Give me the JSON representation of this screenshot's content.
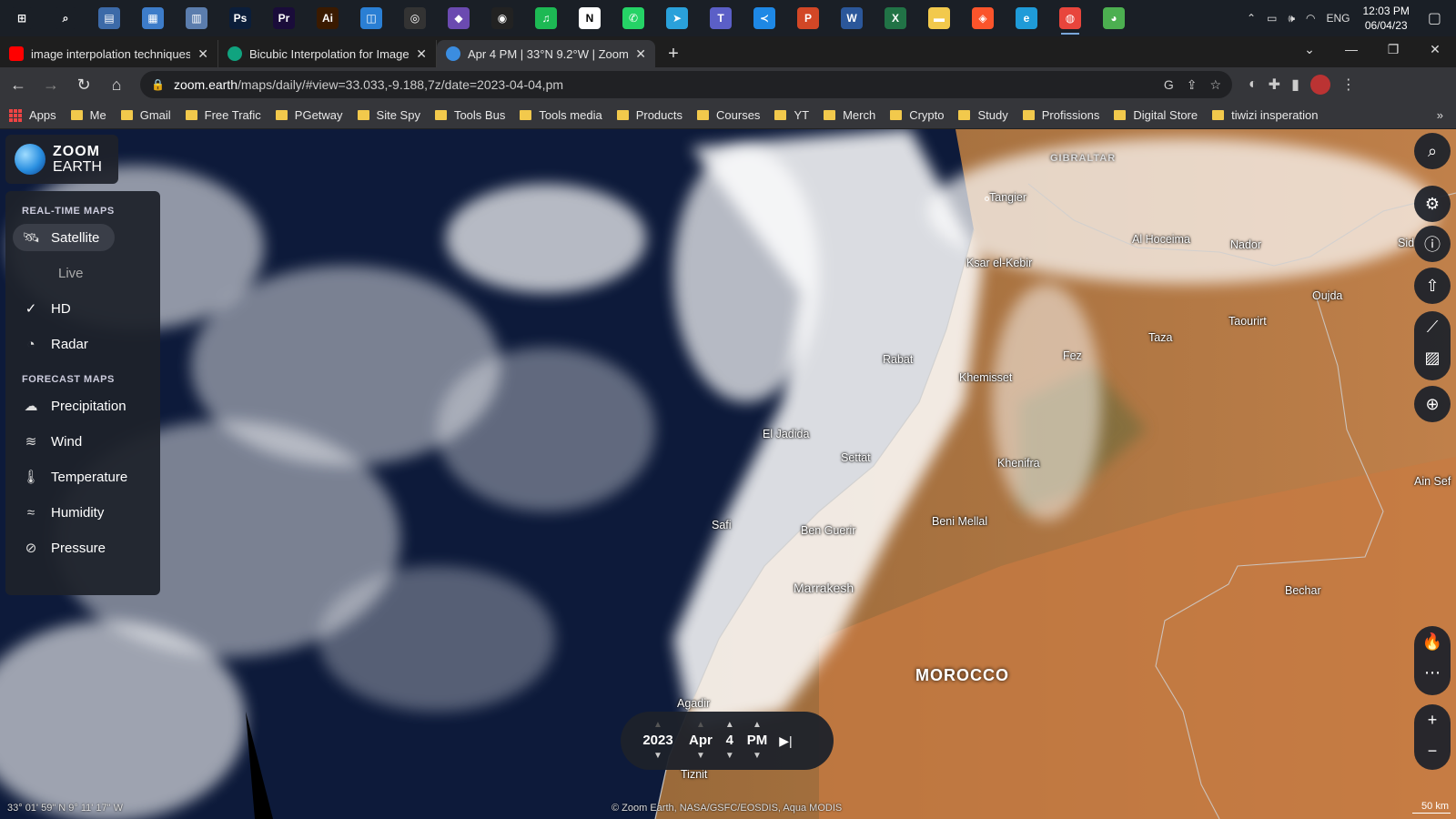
{
  "taskbar": {
    "icons": [
      {
        "name": "start",
        "glyph": "⊞",
        "color": "#1a1f26"
      },
      {
        "name": "search",
        "glyph": "⌕",
        "color": "#1a1f26"
      },
      {
        "name": "app1",
        "glyph": "▤",
        "color": "#3c6aa8"
      },
      {
        "name": "app2",
        "glyph": "▦",
        "color": "#3d7cc9"
      },
      {
        "name": "calculator",
        "glyph": "▥",
        "color": "#5b7dad"
      },
      {
        "name": "photoshop",
        "glyph": "Ps",
        "color": "#0b1e3a"
      },
      {
        "name": "premiere",
        "glyph": "Pr",
        "color": "#1a0c3a"
      },
      {
        "name": "illustrator",
        "glyph": "Ai",
        "color": "#3a1a00"
      },
      {
        "name": "app3",
        "glyph": "◫",
        "color": "#2a7fd4"
      },
      {
        "name": "davinci",
        "glyph": "◎",
        "color": "#333"
      },
      {
        "name": "app4",
        "glyph": "◆",
        "color": "#6b4ab0"
      },
      {
        "name": "obs",
        "glyph": "◉",
        "color": "#222"
      },
      {
        "name": "spotify",
        "glyph": "♫",
        "color": "#1db954"
      },
      {
        "name": "notion",
        "glyph": "N",
        "color": "#fff"
      },
      {
        "name": "whatsapp",
        "glyph": "✆",
        "color": "#25d366"
      },
      {
        "name": "telegram",
        "glyph": "➤",
        "color": "#2aa1da"
      },
      {
        "name": "teams",
        "glyph": "T",
        "color": "#5b5fc7"
      },
      {
        "name": "vscode",
        "glyph": "≺",
        "color": "#1e88e5"
      },
      {
        "name": "powerpoint",
        "glyph": "P",
        "color": "#d24726"
      },
      {
        "name": "word",
        "glyph": "W",
        "color": "#2b579a"
      },
      {
        "name": "excel",
        "glyph": "X",
        "color": "#217346"
      },
      {
        "name": "explorer",
        "glyph": "▬",
        "color": "#f2c94c"
      },
      {
        "name": "brave",
        "glyph": "◈",
        "color": "#fb542b"
      },
      {
        "name": "edge",
        "glyph": "e",
        "color": "#1f9bd8"
      },
      {
        "name": "chrome",
        "glyph": "◍",
        "color": "#e8453c"
      },
      {
        "name": "zoomearth",
        "glyph": "◕",
        "color": "#4caf50"
      }
    ],
    "lang": "ENG",
    "time": "12:03 PM",
    "date": "06/04/23"
  },
  "tabs": [
    {
      "title": "image interpolation techniques -",
      "favicon_color": "#ff0000"
    },
    {
      "title": "Bicubic Interpolation for Images",
      "favicon_color": "#10a37f"
    },
    {
      "title": "Apr 4 PM | 33°N 9.2°W | Zoom Ea",
      "favicon_color": "#3b8de0"
    }
  ],
  "address": {
    "host": "zoom.earth",
    "path": "/maps/daily/#view=33.033,-9.188,7z/date=2023-04-04,pm"
  },
  "bookmarks": [
    "Apps",
    "Me",
    "Gmail",
    "Free Trafic",
    "PGetway",
    "Site Spy",
    "Tools Bus",
    "Tools media",
    "Products",
    "Courses",
    "YT",
    "Merch",
    "Crypto",
    "Study",
    "Profissions",
    "Digital Store",
    "tiwizi insperation"
  ],
  "logo": {
    "line1": "ZOOM",
    "line2": "EARTH"
  },
  "sidebar": {
    "realtime_title": "REAL-TIME MAPS",
    "satellite": "Satellite",
    "live": "Live",
    "hd": "HD",
    "radar": "Radar",
    "forecast_title": "FORECAST MAPS",
    "precipitation": "Precipitation",
    "wind": "Wind",
    "temperature": "Temperature",
    "humidity": "Humidity",
    "pressure": "Pressure"
  },
  "time": {
    "year": "2023",
    "month": "Apr",
    "day": "4",
    "ampm": "PM"
  },
  "places": [
    "GIBRALTAR",
    "Tangier",
    "Al Hoceima",
    "Nador",
    "Ksar el-Kebir",
    "Oujda",
    "Taourirt",
    "Taza",
    "Rabat",
    "Fez",
    "Khemisset",
    "El Jadida",
    "Settat",
    "Khenifra",
    "Safi",
    "Ben Guerir",
    "Beni Mellal",
    "Marrakesh",
    "Bechar",
    "MOROCCO",
    "Agadir",
    "Ain Sef",
    "Sid",
    "Tiznit"
  ],
  "footer": {
    "coords": "33° 01' 59\" N   9° 11' 17\" W",
    "credit": "© Zoom Earth, NASA/GSFC/EOSDIS, Aqua MODIS",
    "scale": "50 km"
  }
}
